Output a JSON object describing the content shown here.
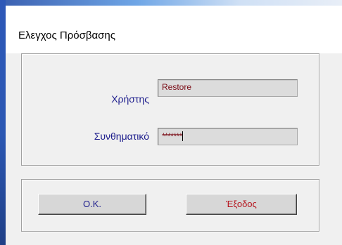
{
  "window": {
    "title": "Ελεγχος Πρόσβασης"
  },
  "login": {
    "user_label": "Χρήστης",
    "user_value": "Restore",
    "password_label": "Συνθηματικό",
    "password_value": "*******"
  },
  "buttons": {
    "ok_label": "O.K.",
    "exit_label": "Έξοδος"
  },
  "colors": {
    "label_text": "#1c1c8c",
    "field_text": "#7a0a14",
    "exit_text": "#b5121b",
    "field_background": "#dcdcdc"
  }
}
